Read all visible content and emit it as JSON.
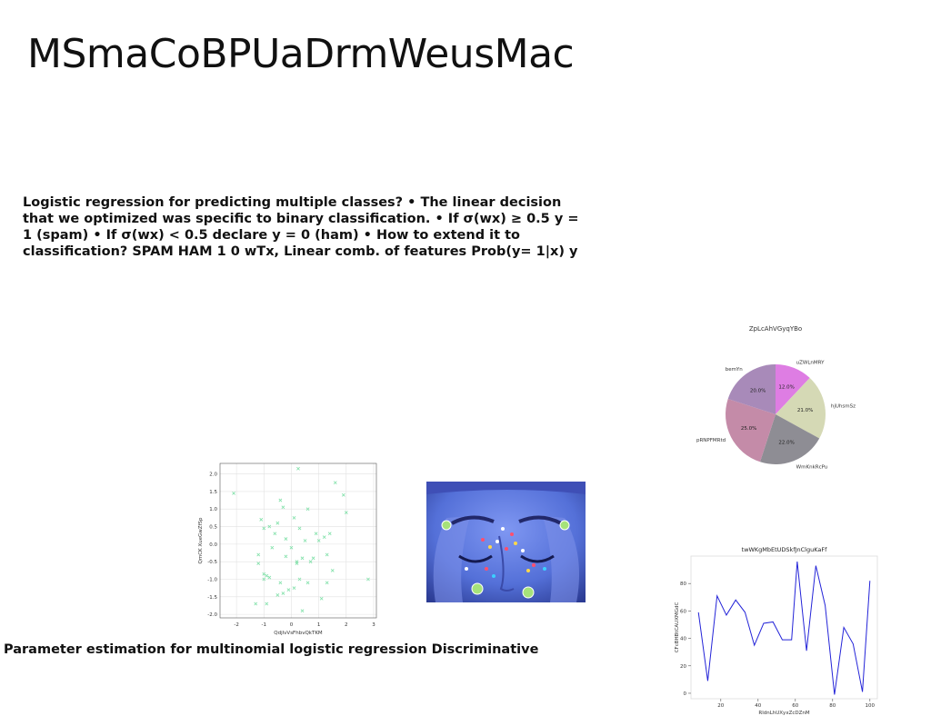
{
  "slide": {
    "title": "MSmaCoBPUaDrmWeusMac",
    "body": "Logistic regression for predicting multiple classes? • The linear decision that we optimized was specific to binary classification. • If σ(w⁣x) ≥ 0.5 y = 1 (spam) • If σ(w⁣x) < 0.5 declare y = 0 (ham) • How to extend it to classification? SPAM HAM 1 0 wTx, Linear comb. of features Prob(y= 1|x) y",
    "caption": "Parameter estimation for multinomial logistic regression Discriminative"
  },
  "chart_data": [
    {
      "type": "pie",
      "title": "ZpLcAhVGyqYBo",
      "labels": [
        "uZWLnMRY",
        "hjUhsmSz",
        "WmKnkRcPu",
        "pRNPFMRtd",
        "bemYn"
      ],
      "values": [
        12.0,
        21.0,
        22.0,
        25.0,
        20.0
      ],
      "value_labels": [
        "12.0%",
        "21.0%",
        "22.0%",
        "25.0%",
        "20.0%"
      ],
      "colors": [
        "#de7de3",
        "#d5d9b5",
        "#8e8d94",
        "#c48ba8",
        "#a88ab9"
      ]
    },
    {
      "type": "scatter",
      "xlabel": "QdjlvVsFhbvQkTKM",
      "ylabel": "QmCK XueGwZfSp",
      "xlim": [
        -2.6,
        3.1
      ],
      "ylim": [
        -2.1,
        2.3
      ],
      "xticks": [
        "-2",
        "-1",
        "0",
        "1",
        "2",
        "3"
      ],
      "yticks": [
        "-2.0",
        "-1.5",
        "-1.0",
        "-0.5",
        "0.0",
        "0.5",
        "1.0",
        "1.5",
        "2.0"
      ],
      "grid": true,
      "marker": "x",
      "color": "#7fe0a8",
      "x": [
        0.25,
        -2.1,
        1.6,
        -0.4,
        1.9,
        -0.3,
        0.6,
        2.0,
        -1.1,
        -0.8,
        -0.5,
        0.1,
        1.2,
        -1.0,
        -0.6,
        0.3,
        0.9,
        1.4,
        -0.2,
        0.5,
        1.0,
        -1.2,
        -0.7,
        0.0,
        0.4,
        1.3,
        -0.9,
        0.2,
        0.7,
        2.8,
        -1.0,
        -0.4,
        0.3,
        1.5,
        -0.8,
        0.1,
        -0.3,
        0.6,
        -0.9,
        -0.1,
        1.1,
        -1.3,
        -0.5,
        0.4,
        0.2,
        -1.2,
        0.8,
        1.3,
        -1.0,
        -0.2
      ],
      "y": [
        2.15,
        1.45,
        1.75,
        1.25,
        1.4,
        1.05,
        1.0,
        0.9,
        0.7,
        0.5,
        0.6,
        0.75,
        0.2,
        0.45,
        0.3,
        0.45,
        0.3,
        0.3,
        0.15,
        0.1,
        0.1,
        -0.3,
        -0.1,
        -0.1,
        -0.4,
        -0.3,
        -0.9,
        -0.5,
        -0.5,
        -1.0,
        -1.0,
        -1.1,
        -1.0,
        -0.75,
        -0.95,
        -1.25,
        -1.4,
        -1.1,
        -1.7,
        -1.3,
        -1.55,
        -1.7,
        -1.45,
        -1.9,
        -0.55,
        -0.55,
        -0.4,
        -1.1,
        -0.85,
        -0.35
      ]
    },
    {
      "type": "line",
      "title": "twWKgMbEtUDSkfJnClguKaFf",
      "xlabel": "RldnLhUXyxZcDZnM",
      "ylabel": "CFcBHBtCAUXMGdC",
      "xlim": [
        4,
        104
      ],
      "ylim": [
        -4,
        100
      ],
      "xticks": [
        20,
        40,
        60,
        80,
        100
      ],
      "yticks": [
        0,
        20,
        40,
        60,
        80
      ],
      "color": "#2424d8",
      "x": [
        8,
        13,
        18,
        23,
        28,
        33,
        38,
        43,
        48,
        53,
        58,
        61,
        66,
        71,
        76,
        81,
        86,
        91,
        96,
        100
      ],
      "y": [
        59,
        9,
        71,
        57,
        68,
        59,
        35,
        51,
        52,
        39,
        39,
        96,
        31,
        93,
        64,
        -1,
        48,
        36,
        1,
        82
      ]
    }
  ]
}
